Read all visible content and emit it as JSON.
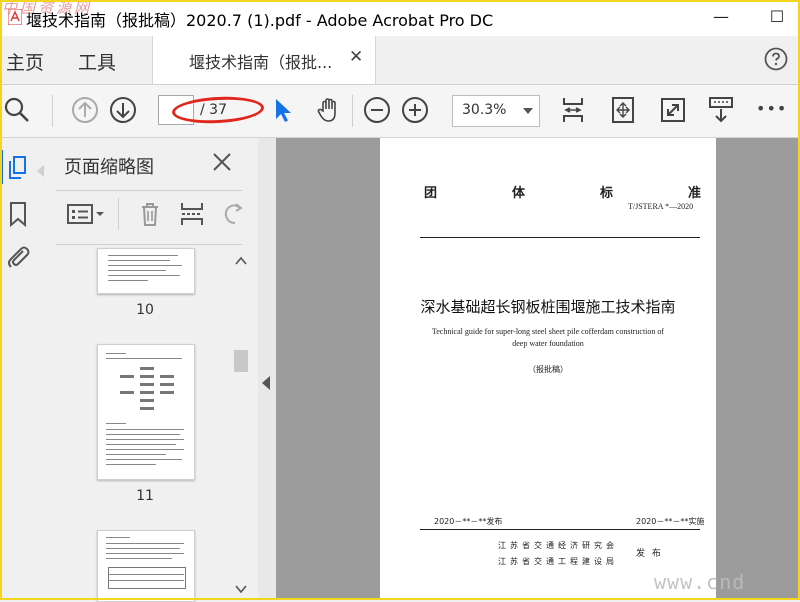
{
  "window": {
    "title": "堰技术指南（报批稿）2020.7 (1).pdf - Adobe Acrobat Pro DC",
    "minimize": "—",
    "maximize": "☐",
    "watermark_top": "中国资源网"
  },
  "tabs": {
    "home": "主页",
    "tools": "工具",
    "document": "堰技术指南（报批...",
    "close": "✕"
  },
  "toolbar": {
    "page_current": "",
    "page_total": "/ 37",
    "zoom": "30.3%",
    "more": "•••"
  },
  "thumbnails_panel": {
    "title": "页面缩略图",
    "pages": [
      {
        "label": "10"
      },
      {
        "label": "11"
      }
    ]
  },
  "document": {
    "header_chars": [
      "团",
      "体",
      "标",
      "准"
    ],
    "code": "T/JSTERA  *—2020",
    "title_cn": "深水基础超长钢板桩围堰施工技术指南",
    "title_en": "Technical guide for super-long steel sheet pile cofferdam construction of deep water foundation",
    "status": "（报批稿）",
    "date_publish": "2020－**－**发布",
    "date_implement": "2020－**－**实施",
    "org_1": "江苏省交通经济研究会",
    "org_2": "江苏省交通工程建设局",
    "publish_label": "发 布",
    "watermark_bottom": "www.cnd"
  },
  "colors": {
    "accent_blue": "#1473e6",
    "annotation_red": "#e0261d",
    "frame_yellow": "#f2d51c"
  }
}
